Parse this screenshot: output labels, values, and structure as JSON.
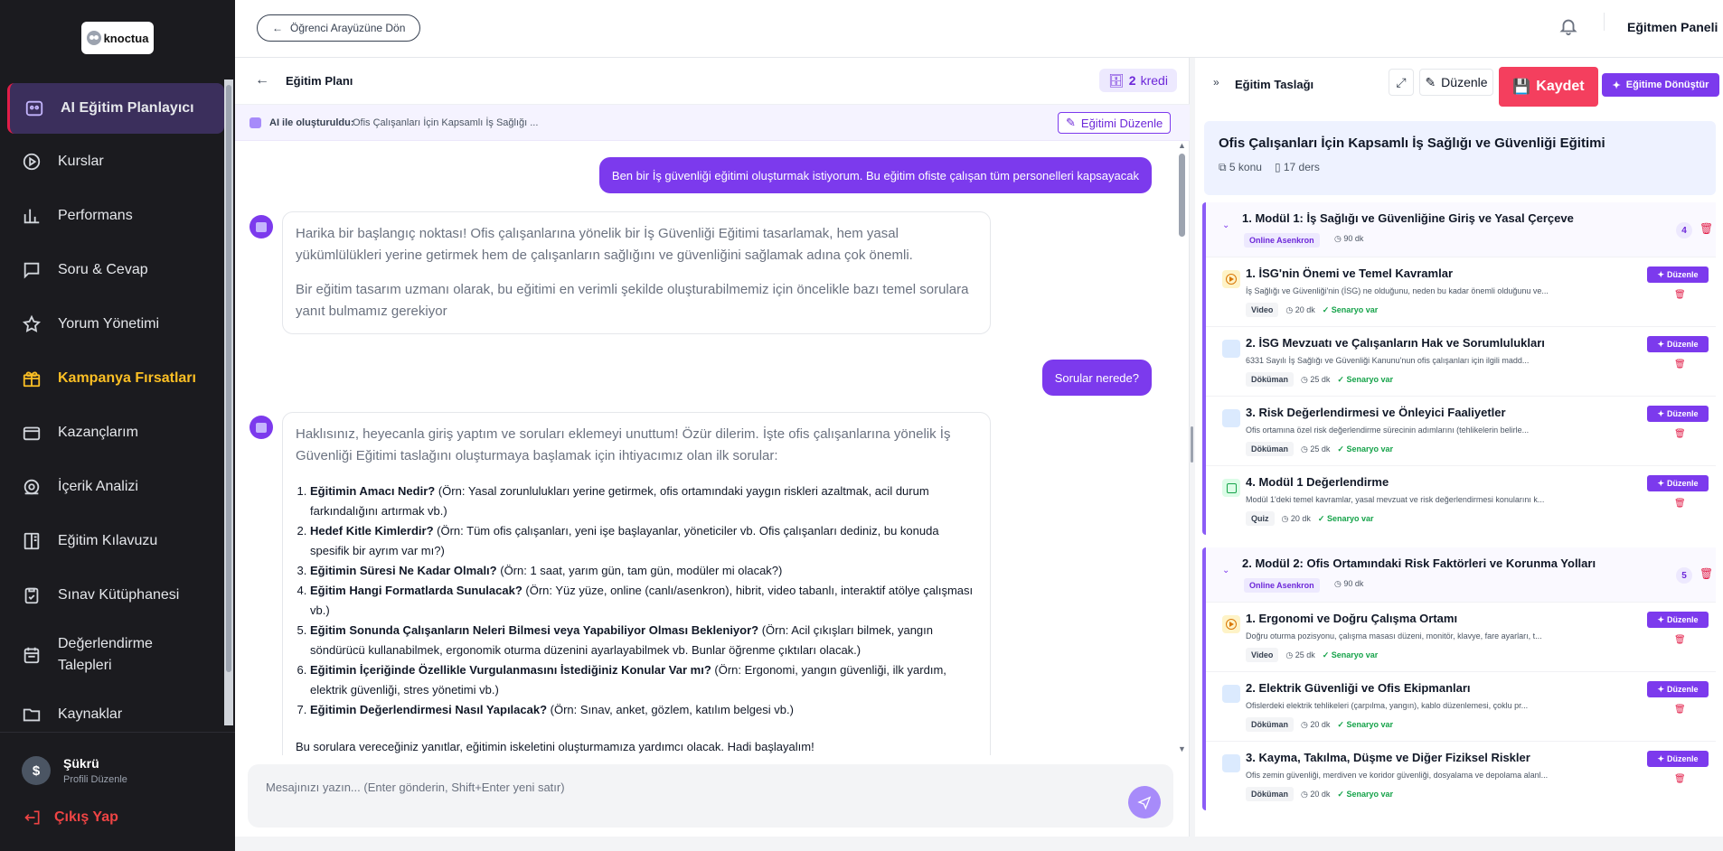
{
  "sidebar": {
    "logo_text": "knoctua",
    "items": [
      {
        "label": "AI Eğitim Planlayıcı",
        "icon": "ai-icon"
      },
      {
        "label": "Kurslar",
        "icon": "play-circle-icon"
      },
      {
        "label": "Performans",
        "icon": "bar-chart-icon"
      },
      {
        "label": "Soru & Cevap",
        "icon": "chat-icon"
      },
      {
        "label": "Yorum Yönetimi",
        "icon": "star-icon"
      },
      {
        "label": "Kampanya Fırsatları",
        "icon": "gift-icon"
      },
      {
        "label": "Kazançlarım",
        "icon": "wallet-icon"
      },
      {
        "label": "İçerik Analizi",
        "icon": "analytics-icon"
      },
      {
        "label": "Eğitim Kılavuzu",
        "icon": "book-icon"
      },
      {
        "label": "Sınav Kütüphanesi",
        "icon": "clipboard-icon"
      },
      {
        "label": "Değerlendirme Talepleri",
        "icon": "calendar-icon"
      },
      {
        "label": "Kaynaklar",
        "icon": "folder-icon"
      }
    ],
    "profile": {
      "initial": "$",
      "name": "Şükrü",
      "sub": "Profili Düzenle"
    },
    "logout": "Çıkış Yap"
  },
  "topbar": {
    "back_label": "Öğrenci Arayüzüne Dön",
    "panel_name": "Eğitmen Paneli"
  },
  "chat": {
    "title": "Eğitim Planı",
    "credit_value": "2",
    "credit_unit": "kredi",
    "ai_label": "AI ile oluşturuldu:",
    "ai_value": "Ofis Çalışanları İçin Kapsamlı İş Sağlığı ...",
    "edit_training": "Eğitimi Düzenle",
    "msg1_user": "Ben bir İş güvenliği eğitimi oluşturmak istiyorum. Bu eğitim ofiste çalışan tüm personelleri kapsayacak",
    "msg2_ai_p1": "Harika bir başlangıç noktası! Ofis çalışanlarına yönelik bir İş Güvenliği Eğitimi tasarlamak, hem yasal yükümlülükleri yerine getirmek hem de çalışanların sağlığını ve güvenliğini sağlamak adına çok önemli.",
    "msg2_ai_p2": "Bir eğitim tasarım uzmanı olarak, bu eğitimi en verimli şekilde oluşturabilmemiz için öncelikle bazı temel sorulara yanıt bulmamız gerekiyor",
    "msg3_user": "Sorular nerede?",
    "msg4_ai_intro": "Haklısınız, heyecanla giriş yaptım ve soruları eklemeyi unuttum! Özür dilerim. İşte ofis çalışanlarına yönelik İş Güvenliği Eğitimi taslağını oluşturmaya başlamak için ihtiyacımız olan ilk sorular:",
    "questions": [
      {
        "q": "Eğitimin Amacı Nedir?",
        "a": " (Örn: Yasal zorunlulukları yerine getirmek, ofis ortamındaki yaygın riskleri azaltmak, acil durum farkındalığını artırmak vb.)"
      },
      {
        "q": "Hedef Kitle Kimlerdir?",
        "a": " (Örn: Tüm ofis çalışanları, yeni işe başlayanlar, yöneticiler vb. Ofis çalışanları dediniz, bu konuda spesifik bir ayrım var mı?)"
      },
      {
        "q": "Eğitimin Süresi Ne Kadar Olmalı?",
        "a": " (Örn: 1 saat, yarım gün, tam gün, modüler mi olacak?)"
      },
      {
        "q": "Eğitim Hangi Formatlarda Sunulacak?",
        "a": " (Örn: Yüz yüze, online (canlı/asenkron), hibrit, video tabanlı, interaktif atölye çalışması vb.)"
      },
      {
        "q": "Eğitim Sonunda Çalışanların Neleri Bilmesi veya Yapabiliyor Olması Bekleniyor?",
        "a": " (Örn: Acil çıkışları bilmek, yangın söndürücü kullanabilmek, ergonomik oturma düzenini ayarlayabilmek vb. Bunlar öğrenme çıktıları olacak.)"
      },
      {
        "q": "Eğitimin İçeriğinde Özellikle Vurgulanmasını İstediğiniz Konular Var mı?",
        "a": " (Örn: Ergonomi, yangın güvenliği, ilk yardım, elektrik güvenliği, stres yönetimi vb.)"
      },
      {
        "q": "Eğitimin Değerlendirmesi Nasıl Yapılacak?",
        "a": " (Örn: Sınav, anket, gözlem, katılım belgesi vb.)"
      }
    ],
    "msg4_tail": "Bu sorulara vereceğiniz yanıtlar, eğitimin iskeletini oluşturmamıza yardımcı olacak. Hadi başlayalım!",
    "composer_placeholder": "Mesajınızı yazın... (Enter gönderin, Shift+Enter yeni satır)"
  },
  "draft": {
    "title": "Eğitim Taslağı",
    "edit": "Düzenle",
    "save": "Kaydet",
    "convert": "Eğitime Dönüştür",
    "course_title": "Ofis Çalışanları İçin Kapsamlı İş Sağlığı ve Güvenliği Eğitimi",
    "topics": "5 konu",
    "lessons_count": "17 ders",
    "lesson_edit": "Düzenle",
    "scenario": "Senaryo var",
    "modules": [
      {
        "title": "1. Modül 1: İş Sağlığı ve Güvenliğine Giriş ve Yasal Çerçeve",
        "mode": "Online Asenkron",
        "duration": "90 dk",
        "count": "4",
        "lessons": [
          {
            "title": "1. İSG'nin Önemi ve Temel Kavramlar",
            "desc": "İş Sağlığı ve Güvenliği'nin (İSG) ne olduğunu, neden bu kadar önemli olduğunu ve...",
            "type": "Video",
            "time": "20 dk",
            "kind": "video"
          },
          {
            "title": "2. İSG Mevzuatı ve Çalışanların Hak ve Sorumlulukları",
            "desc": "6331 Sayılı İş Sağlığı ve Güvenliği Kanunu'nun ofis çalışanları için ilgili madd...",
            "type": "Döküman",
            "time": "25 dk",
            "kind": "doc"
          },
          {
            "title": "3. Risk Değerlendirmesi ve Önleyici Faaliyetler",
            "desc": "Ofis ortamına özel risk değerlendirme sürecinin adımlarını (tehlikelerin belirle...",
            "type": "Döküman",
            "time": "25 dk",
            "kind": "doc"
          },
          {
            "title": "4. Modül 1 Değerlendirme",
            "desc": "Modül 1'deki temel kavramlar, yasal mevzuat ve risk değerlendirmesi konularını k...",
            "type": "Quiz",
            "time": "20 dk",
            "kind": "quiz"
          }
        ]
      },
      {
        "title": "2. Modül 2: Ofis Ortamındaki Risk Faktörleri ve Korunma Yolları",
        "mode": "Online Asenkron",
        "duration": "90 dk",
        "count": "5",
        "lessons": [
          {
            "title": "1. Ergonomi ve Doğru Çalışma Ortamı",
            "desc": "Doğru oturma pozisyonu, çalışma masası düzeni, monitör, klavye, fare ayarları, t...",
            "type": "Video",
            "time": "25 dk",
            "kind": "video"
          },
          {
            "title": "2. Elektrik Güvenliği ve Ofis Ekipmanları",
            "desc": "Ofislerdeki elektrik tehlikeleri (çarpılma, yangın), kablo düzenlemesi, çoklu pr...",
            "type": "Döküman",
            "time": "20 dk",
            "kind": "doc"
          },
          {
            "title": "3. Kayma, Takılma, Düşme ve Diğer Fiziksel Riskler",
            "desc": "Ofis zemin güvenliği, merdiven ve koridor güvenliği, dosyalama ve depolama alanl...",
            "type": "Döküman",
            "time": "20 dk",
            "kind": "doc"
          }
        ]
      }
    ]
  },
  "colors": {
    "accent": "#7c3aed",
    "save": "#f43f5e",
    "sidebar_bg": "#1b1b1f",
    "danger": "#e11d48",
    "success": "#16a34a"
  }
}
